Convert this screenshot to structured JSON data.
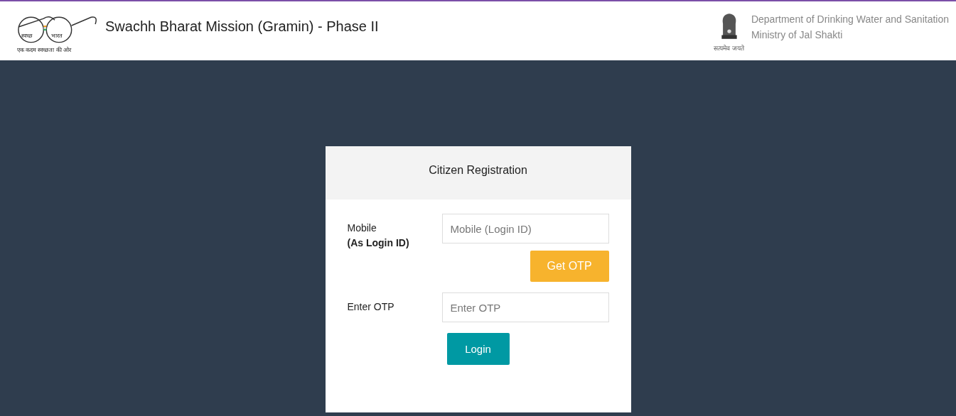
{
  "header": {
    "logo": {
      "left_word": "स्वच्छ",
      "right_word": "भारत",
      "tagline": "एक कदम स्वच्छता की ओर"
    },
    "title": "Swachh Bharat Mission (Gramin) - Phase II",
    "emblem_motto": "सत्यमेव जयते",
    "department": "Department of Drinking Water and Sanitation",
    "ministry": "Ministry of Jal Shakti"
  },
  "form": {
    "title": "Citizen Registration",
    "rows": [
      {
        "kind": "field",
        "label": "Mobile **(As Login ID)**",
        "placeholder": "Mobile (Login ID)",
        "button": "Get OTP"
      },
      {
        "kind": "field",
        "label": "Enter OTP",
        "placeholder": "Enter OTP"
      }
    ],
    "submit": "Login"
  }
}
